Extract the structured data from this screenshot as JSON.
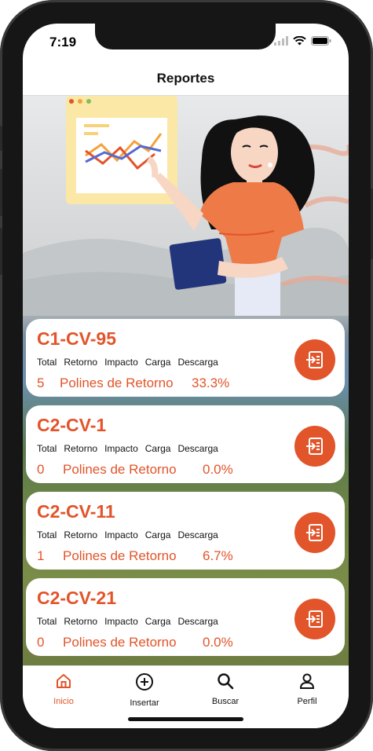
{
  "status_bar": {
    "time": "7:19"
  },
  "header": {
    "title": "Reportes"
  },
  "cards": [
    {
      "code": "C1-CV-95",
      "labels": [
        "Total",
        "Retorno",
        "Impacto",
        "Carga",
        "Descarga"
      ],
      "count": "5",
      "category": "Polines de Retorno",
      "percent": "33.3%"
    },
    {
      "code": "C2-CV-1",
      "labels": [
        "Total",
        "Retorno",
        "Impacto",
        "Carga",
        "Descarga"
      ],
      "count": "0",
      "category": "Polines de Retorno",
      "percent": "0.0%"
    },
    {
      "code": "C2-CV-11",
      "labels": [
        "Total",
        "Retorno",
        "Impacto",
        "Carga",
        "Descarga"
      ],
      "count": "1",
      "category": "Polines de Retorno",
      "percent": "6.7%"
    },
    {
      "code": "C2-CV-21",
      "labels": [
        "Total",
        "Retorno",
        "Impacto",
        "Carga",
        "Descarga"
      ],
      "count": "0",
      "category": "Polines de Retorno",
      "percent": "0.0%"
    }
  ],
  "tabbar": {
    "items": [
      {
        "label": "Inicio",
        "icon": "home-icon",
        "active": true
      },
      {
        "label": "Insertar",
        "icon": "plus-circle-icon",
        "active": false
      },
      {
        "label": "Buscar",
        "icon": "search-icon",
        "active": false
      },
      {
        "label": "Perfil",
        "icon": "user-icon",
        "active": false
      }
    ]
  },
  "colors": {
    "accent": "#e2542a",
    "card_bg": "#ffffff",
    "text": "#111111"
  }
}
